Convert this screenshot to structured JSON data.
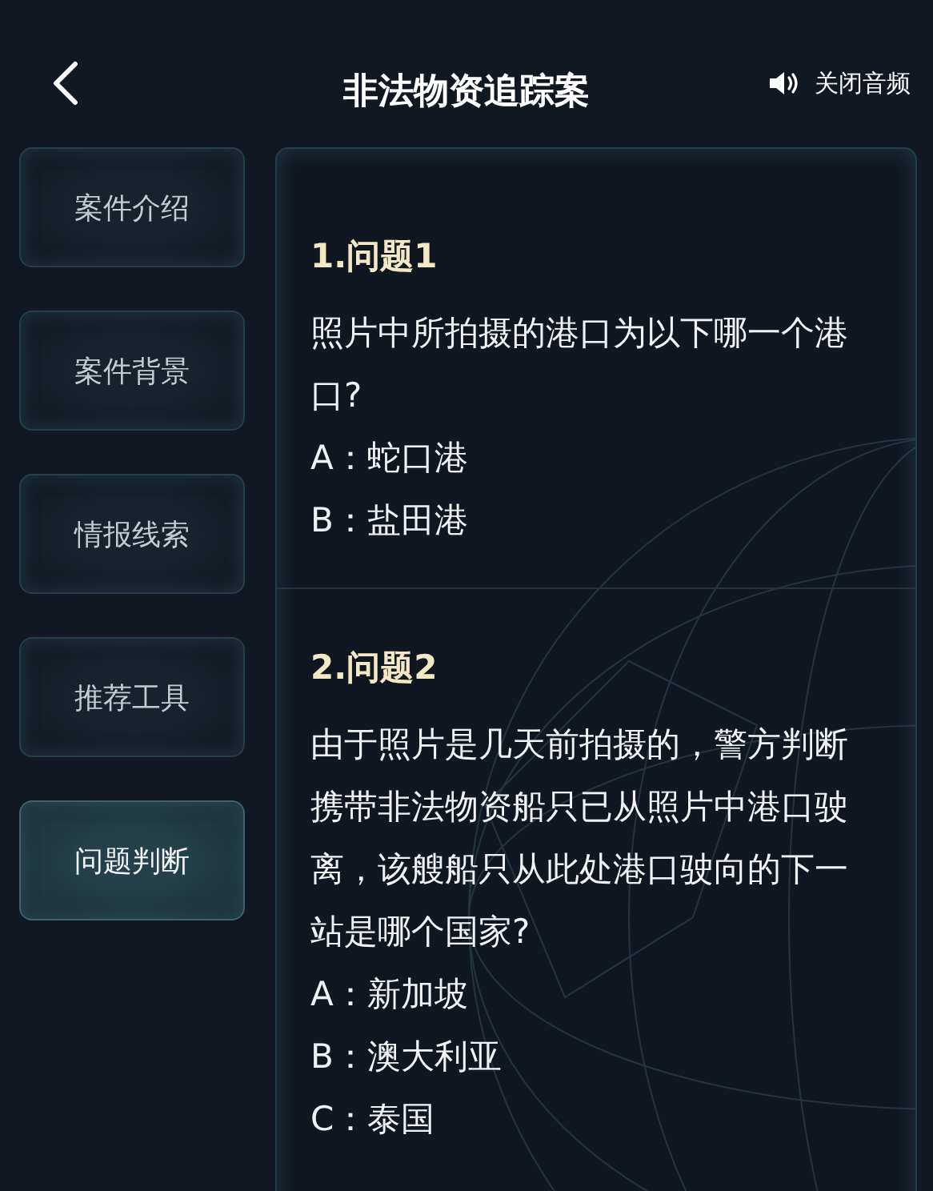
{
  "header": {
    "title": "非法物资追踪案",
    "sound_button": "关闭音频"
  },
  "sidebar": {
    "items": [
      {
        "label": "案件介绍",
        "selected": false
      },
      {
        "label": "案件背景",
        "selected": false
      },
      {
        "label": "情报线索",
        "selected": false
      },
      {
        "label": "推荐工具",
        "selected": false
      },
      {
        "label": "问题判断",
        "selected": true
      }
    ]
  },
  "questions": [
    {
      "title": "1.问题1",
      "text": "照片中所拍摄的港口为以下哪一个港口?",
      "options": [
        "A：蛇口港",
        "B：盐田港"
      ]
    },
    {
      "title": "2.问题2",
      "text": "由于照片是几天前拍摄的，警方判断携带非法物资船只已从照片中港口驶离，该艘船只从此处港口驶向的下一站是哪个国家?",
      "options": [
        "A：新加坡",
        "B：澳大利亚",
        "C：泰国"
      ]
    }
  ]
}
